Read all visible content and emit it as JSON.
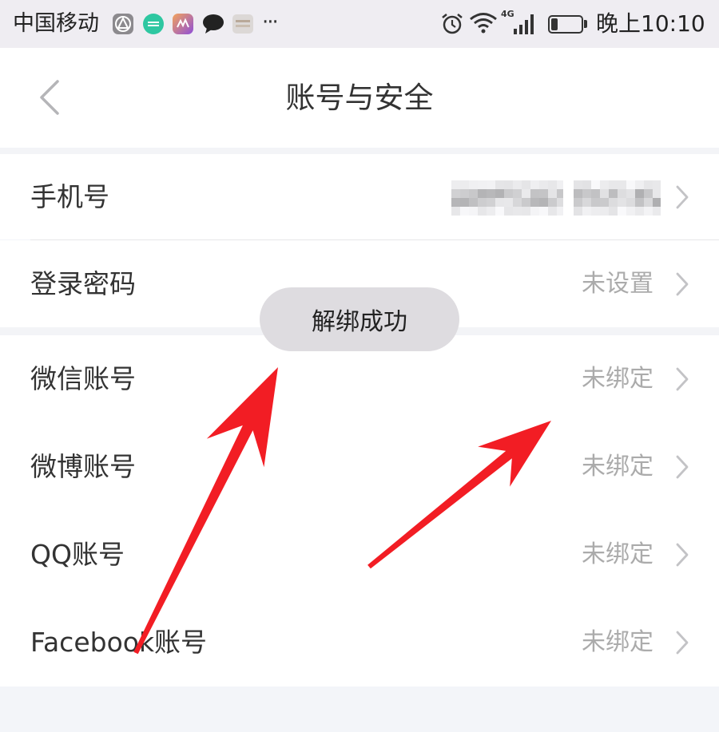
{
  "status_bar": {
    "carrier": "中国移动",
    "notification_icons": [
      "gray-app-icon",
      "green-app-icon",
      "music-app-icon",
      "chat-bubble-icon",
      "light-app-icon"
    ],
    "overflow": "···",
    "right_icons": [
      "alarm-icon",
      "wifi-icon",
      "signal-icon",
      "battery-icon"
    ],
    "network_type": "4G",
    "battery_level": 0.22,
    "time": "晚上10:10"
  },
  "header": {
    "back_icon": "chevron-left-icon",
    "title": "账号与安全"
  },
  "sections": [
    {
      "rows": [
        {
          "label": "手机号",
          "value_redacted": true
        },
        {
          "label": "登录密码",
          "value": "未设置"
        }
      ]
    },
    {
      "rows": [
        {
          "label": "微信账号",
          "value": "未绑定"
        },
        {
          "label": "微博账号",
          "value": "未绑定"
        },
        {
          "label": "QQ账号",
          "value": "未绑定"
        },
        {
          "label": "Facebook账号",
          "value": "未绑定"
        }
      ]
    }
  ],
  "toast": {
    "text": "解绑成功"
  },
  "colors": {
    "status_bar_bg": "#efedf2",
    "text_primary": "#333333",
    "text_secondary": "#ababab",
    "toast_bg": "#dedce0",
    "annotation_arrow": "#f21d24"
  }
}
